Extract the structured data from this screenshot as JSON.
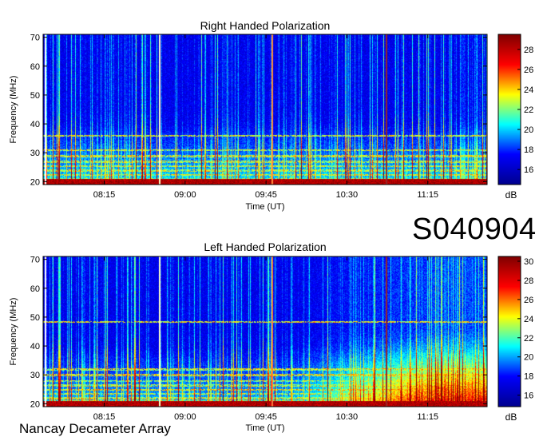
{
  "station_label": "S040904",
  "observatory": "Nancay Decameter Array",
  "chart_data": [
    {
      "type": "heatmap",
      "title": "Right Handed Polarization",
      "xlabel": "Time (UT)",
      "ylabel": "Frequency (MHz)",
      "colorbar_label": "dB",
      "x_ticks": [
        "08:15",
        "09:00",
        "09:45",
        "10:30",
        "11:15"
      ],
      "x_tick_minutes": [
        495,
        540,
        585,
        630,
        675
      ],
      "xlim_minutes": [
        461,
        708
      ],
      "y_ticks": [
        20,
        30,
        40,
        50,
        60,
        70
      ],
      "ylim": [
        19,
        71
      ],
      "colorbar_ticks": [
        16,
        18,
        20,
        22,
        24,
        26,
        28
      ],
      "clim": [
        14.5,
        29.5
      ],
      "colormap": [
        "#00008f",
        "#0000ff",
        "#00ffff",
        "#ffff00",
        "#ff0000",
        "#800000"
      ],
      "activity_level": 0.3
    },
    {
      "type": "heatmap",
      "title": "Left Handed Polarization",
      "xlabel": "Time (UT)",
      "ylabel": "Frequency (MHz)",
      "colorbar_label": "dB",
      "x_ticks": [
        "08:15",
        "09:00",
        "09:45",
        "10:30",
        "11:15"
      ],
      "x_tick_minutes": [
        495,
        540,
        585,
        630,
        675
      ],
      "xlim_minutes": [
        461,
        708
      ],
      "y_ticks": [
        20,
        30,
        40,
        50,
        60,
        70
      ],
      "ylim": [
        19,
        71
      ],
      "colorbar_ticks": [
        16,
        18,
        20,
        22,
        24,
        26,
        28,
        30
      ],
      "clim": [
        14.8,
        30.5
      ],
      "colormap": [
        "#00008f",
        "#0000ff",
        "#00ffff",
        "#ffff00",
        "#ff0000",
        "#800000"
      ],
      "activity_level": 0.6
    }
  ]
}
